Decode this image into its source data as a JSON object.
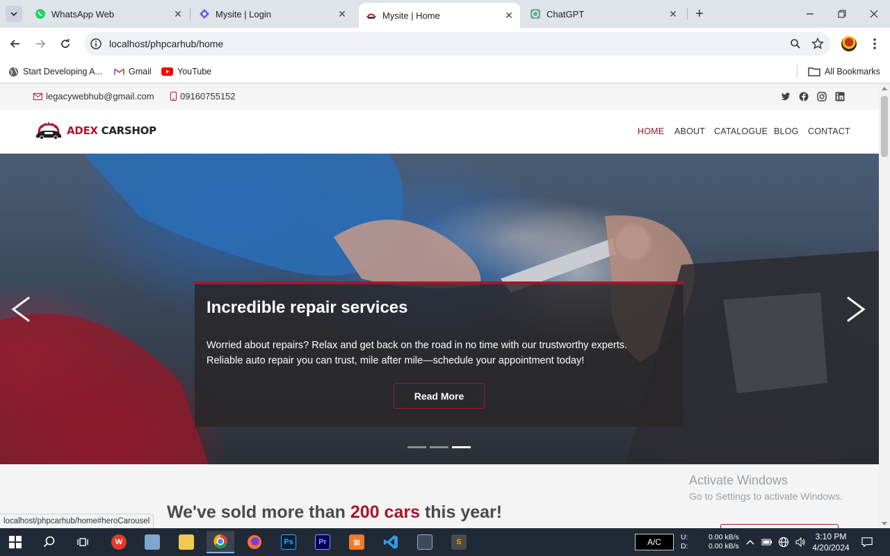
{
  "browser": {
    "tabs": [
      {
        "title": "WhatsApp Web",
        "icon": "whatsapp-icon",
        "active": false
      },
      {
        "title": "Mysite | Login",
        "icon": "site-icon",
        "active": false
      },
      {
        "title": "Mysite | Home",
        "icon": "carshop-icon",
        "active": true
      },
      {
        "title": "ChatGPT",
        "icon": "chatgpt-icon",
        "active": false
      }
    ],
    "url": "localhost/phpcarhub/home",
    "bookmarks": [
      {
        "label": "Start Developing A...",
        "icon": "globe-icon"
      },
      {
        "label": "Gmail",
        "icon": "gmail-icon"
      },
      {
        "label": "YouTube",
        "icon": "youtube-icon"
      }
    ],
    "all_bookmarks": "All Bookmarks",
    "status_url": "localhost/phpcarhub/home#heroCarousel"
  },
  "site": {
    "topbar": {
      "email": "legacywebhub@gmail.com",
      "phone": "09160755152",
      "socials": [
        "twitter-icon",
        "facebook-icon",
        "instagram-icon",
        "linkedin-icon"
      ]
    },
    "brand": {
      "part1": "ADEX",
      "part2": "CARSHOP"
    },
    "nav": [
      {
        "label": "HOME",
        "active": true
      },
      {
        "label": "ABOUT",
        "active": false
      },
      {
        "label": "CATALOGUE",
        "active": false
      },
      {
        "label": "BLOG",
        "active": false
      },
      {
        "label": "CONTACT",
        "active": false
      }
    ],
    "hero": {
      "title": "Incredible repair services",
      "text": "Worried about repairs? Relax and get back on the road in no time with our trustworthy experts. Reliable auto repair you can trust, mile after mile—schedule your appointment today!",
      "button": "Read More",
      "slides": 3,
      "active_slide": 3
    },
    "stats": {
      "prefix": "We've sold more than",
      "highlight": "200 cars",
      "suffix": "this year!"
    }
  },
  "watermark": {
    "line1": "Activate Windows",
    "line2": "Go to Settings to activate Windows."
  },
  "taskbar": {
    "ac": "A/C",
    "upload_label": "U:",
    "download_label": "D:",
    "upload_speed": "0.00 kB/s",
    "download_speed": "0.00 kB/s",
    "time": "3:10 PM",
    "date": "4/20/2024"
  },
  "colors": {
    "accent": "#a5172a",
    "nav_active": "#9b1424"
  }
}
